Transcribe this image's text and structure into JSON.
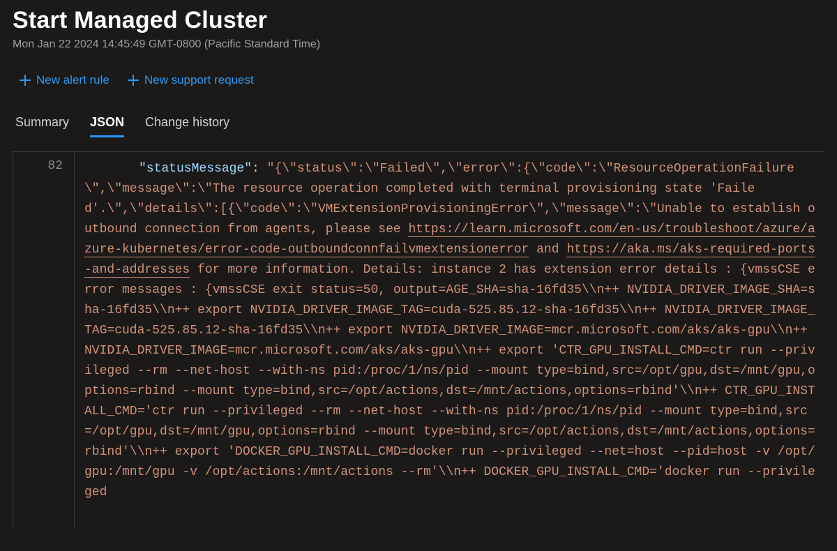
{
  "header": {
    "title": "Start Managed Cluster",
    "timestamp": "Mon Jan 22 2024 14:45:49 GMT-0800 (Pacific Standard Time)"
  },
  "actions": {
    "new_alert_rule": "New alert rule",
    "new_support_request": "New support request"
  },
  "tabs": {
    "summary": "Summary",
    "json": "JSON",
    "change_history": "Change history",
    "selected": "json"
  },
  "editor": {
    "line_number": "82",
    "json_key": "\"statusMessage\"",
    "colon": ": ",
    "value_pre_link1": "\"{\\\"status\\\":\\\"Failed\\\",\\\"error\\\":{\\\"code\\\":\\\"ResourceOperationFailure\\\",\\\"message\\\":\\\"The resource operation completed with terminal provisioning state 'Failed'.\\\",\\\"details\\\":[{\\\"code\\\":\\\"VMExtensionProvisioningError\\\",\\\"message\\\":\\\"Unable to establish outbound connection from agents, please see ",
    "link1": "https://learn.microsoft.com/en-us/troubleshoot/azure/azure-kubernetes/error-code-outboundconnfailvmextensionerror",
    "mid1": " and ",
    "link2": "https://aka.ms/aks-required-ports-and-addresses",
    "value_post_link2": " for more information. Details: instance 2 has extension error details : {vmssCSE error messages : {vmssCSE exit status=50, output=AGE_SHA=sha-16fd35\\\\n++ NVIDIA_DRIVER_IMAGE_SHA=sha-16fd35\\\\n++ export NVIDIA_DRIVER_IMAGE_TAG=cuda-525.85.12-sha-16fd35\\\\n++ NVIDIA_DRIVER_IMAGE_TAG=cuda-525.85.12-sha-16fd35\\\\n++ export NVIDIA_DRIVER_IMAGE=mcr.microsoft.com/aks/aks-gpu\\\\n++ NVIDIA_DRIVER_IMAGE=mcr.microsoft.com/aks/aks-gpu\\\\n++ export 'CTR_GPU_INSTALL_CMD=ctr run --privileged --rm --net-host --with-ns pid:/proc/1/ns/pid --mount type=bind,src=/opt/gpu,dst=/mnt/gpu,options=rbind --mount type=bind,src=/opt/actions,dst=/mnt/actions,options=rbind'\\\\n++ CTR_GPU_INSTALL_CMD='ctr run --privileged --rm --net-host --with-ns pid:/proc/1/ns/pid --mount type=bind,src=/opt/gpu,dst=/mnt/gpu,options=rbind --mount type=bind,src=/opt/actions,dst=/mnt/actions,options=rbind'\\\\n++ export 'DOCKER_GPU_INSTALL_CMD=docker run --privileged --net=host --pid=host -v /opt/gpu:/mnt/gpu -v /opt/actions:/mnt/actions --rm'\\\\n++ DOCKER_GPU_INSTALL_CMD='docker run --privileged"
  }
}
